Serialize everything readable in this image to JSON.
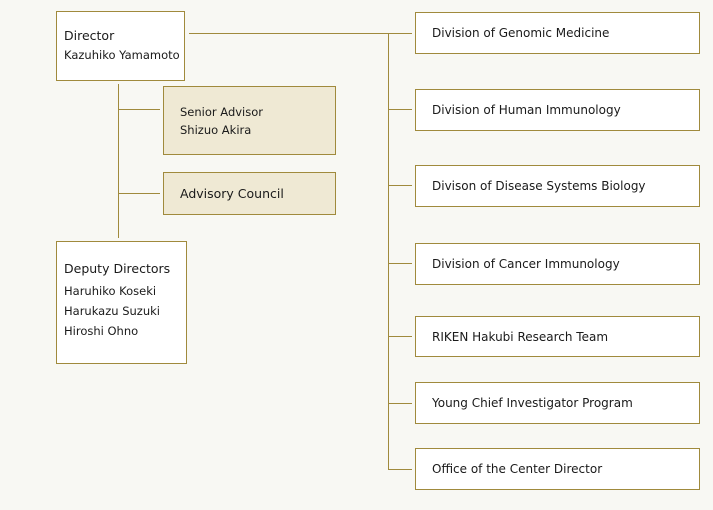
{
  "director": {
    "title": "Director",
    "name": "Kazuhiko Yamamoto"
  },
  "senior_advisor": {
    "title": "Senior Advisor",
    "name": "Shizuo Akira"
  },
  "advisory_council": {
    "title": "Advisory Council"
  },
  "deputy_directors": {
    "title": "Deputy Directors",
    "names": [
      "Haruhiko Koseki",
      "Harukazu Suzuki",
      "Hiroshi Ohno"
    ]
  },
  "divisions": [
    "Division of Genomic Medicine",
    "Division of Human Immunology",
    "Divison of Disease Systems Biology",
    "Division of Cancer Immunology",
    "RIKEN Hakubi Research Team",
    "Young Chief Investigator Program",
    "Office of the Center Director"
  ],
  "colors": {
    "line": "#a08a3c",
    "shade": "#efe9d4",
    "background": "#f8f8f3"
  }
}
